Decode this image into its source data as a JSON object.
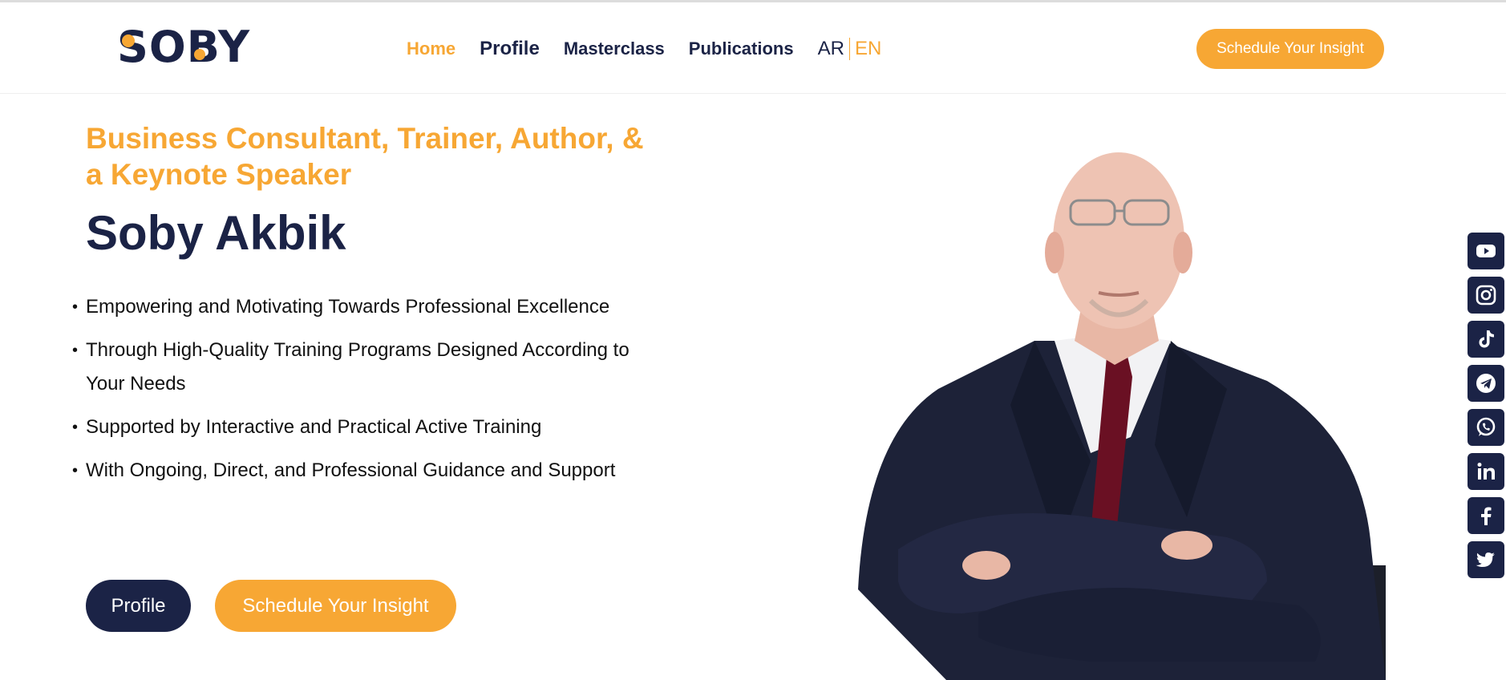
{
  "logo": {
    "text": "SOBY",
    "brand_color": "#f7a734",
    "navy_color": "#1b2346"
  },
  "nav": {
    "items": [
      {
        "label": "Home",
        "active": true
      },
      {
        "label": "Profile",
        "active": false
      },
      {
        "label": "Masterclass",
        "active": false
      },
      {
        "label": "Publications",
        "active": false
      }
    ],
    "lang_ar": "AR",
    "lang_en": "EN"
  },
  "header": {
    "cta_label": "Schedule Your Insight"
  },
  "hero": {
    "subtitle": "Business Consultant, Trainer, Author, & a Keynote Speaker",
    "name": "Soby Akbik",
    "bullets": [
      "Empowering and Motivating Towards Professional Excellence",
      "Through High-Quality Training Programs Designed According to Your Needs",
      "Supported by Interactive and Practical Active Training",
      "With Ongoing, Direct, and Professional Guidance and Support"
    ],
    "profile_button": "Profile",
    "schedule_button": "Schedule Your Insight"
  },
  "social": [
    "youtube-icon",
    "instagram-icon",
    "tiktok-icon",
    "telegram-icon",
    "whatsapp-icon",
    "linkedin-icon",
    "facebook-icon",
    "twitter-icon"
  ]
}
